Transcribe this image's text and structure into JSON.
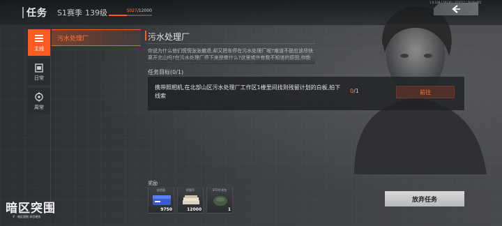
{
  "header": {
    "title": "任务",
    "season": "S1赛季",
    "level": "139级",
    "xp_current": "5027",
    "xp_total": "/12000",
    "xp_fraction": 0.42,
    "version": "1.0.128.126136 | 322017 | 5b36e6f2"
  },
  "sidebar": {
    "tabs": [
      {
        "label": "主线",
        "icon": "list-icon",
        "active": true
      },
      {
        "label": "日常",
        "icon": "calendar-icon",
        "active": false
      },
      {
        "label": "周常",
        "icon": "target-icon",
        "active": false
      }
    ]
  },
  "quest_list": {
    "items": [
      {
        "label": "污水处理厂"
      }
    ]
  },
  "detail": {
    "title": "污水处理厂",
    "description": "你说为什么他们慌慌张张撤退,却又把车停在污水处理厂呢?难道不是应该尽快离开北山吗?在污水处理厂停下来是做什么?这里或许有我不知道的原因,你能再去一趟污水处理厂吗?到里面去看看,找找些线索来就",
    "objective_label": "任务目标(0/1)",
    "objective_text": "携带照相机,在北部山区污水处理厂工作区1楼里间找到残留计划的白板,拍下线索",
    "objective_done": "0",
    "objective_total": "/1",
    "goto_label": "前往"
  },
  "rewards": {
    "label": "奖励",
    "items": [
      {
        "name": "经验值",
        "count": "9750",
        "icon": "exp-card-icon"
      },
      {
        "name": "柯恩币",
        "count": "12000",
        "icon": "cash-stack-icon"
      },
      {
        "name": "STO手术包",
        "count": "1",
        "icon": "medkit-bag-icon"
      }
    ]
  },
  "abandon_label": "放弃任务",
  "logo": {
    "main": "暗区突围",
    "sub": "#ㅤ暗区限制 体验硬核ㅤ"
  },
  "colors": {
    "accent": "#ff5a1f"
  }
}
